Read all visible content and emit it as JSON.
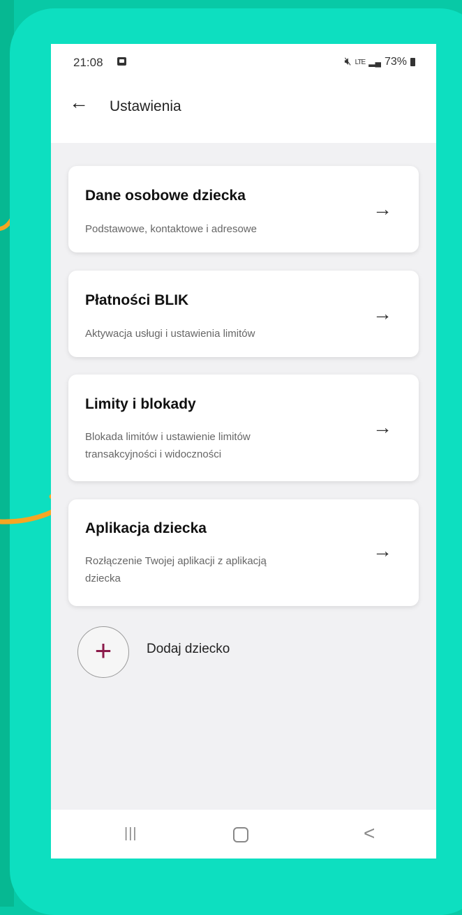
{
  "status_bar": {
    "time": "21:08",
    "network": "LTE",
    "battery": "73%"
  },
  "header": {
    "back_icon": "arrow-left-icon",
    "title": "Ustawienia"
  },
  "cards": [
    {
      "title": "Dane osobowe dziecka",
      "subtitle": "Podstawowe, kontaktowe i adresowe",
      "arrow": "→"
    },
    {
      "title": "Płatności BLIK",
      "subtitle": "Aktywacja usługi i ustawienia limitów",
      "arrow": "→"
    },
    {
      "title": "Limity i blokady",
      "subtitle_line1": "Blokada limitów i ustawienie limitów",
      "subtitle_line2": "transakcyjności i widoczności",
      "arrow": "→"
    },
    {
      "title": "Aplikacja dziecka",
      "subtitle_line1": "Rozłączenie Twojej aplikacji z aplikacją",
      "subtitle_line2": "dziecka",
      "arrow": "→"
    }
  ],
  "add_child": {
    "icon": "plus-icon",
    "label": "Dodaj dziecko"
  },
  "nav_bar": {
    "recent": "|||",
    "back": "<"
  },
  "colors": {
    "background": "#08c9a6",
    "frame": "#0ddfc0",
    "annotation": "#f5a623",
    "plus": "#8b1a4a"
  }
}
